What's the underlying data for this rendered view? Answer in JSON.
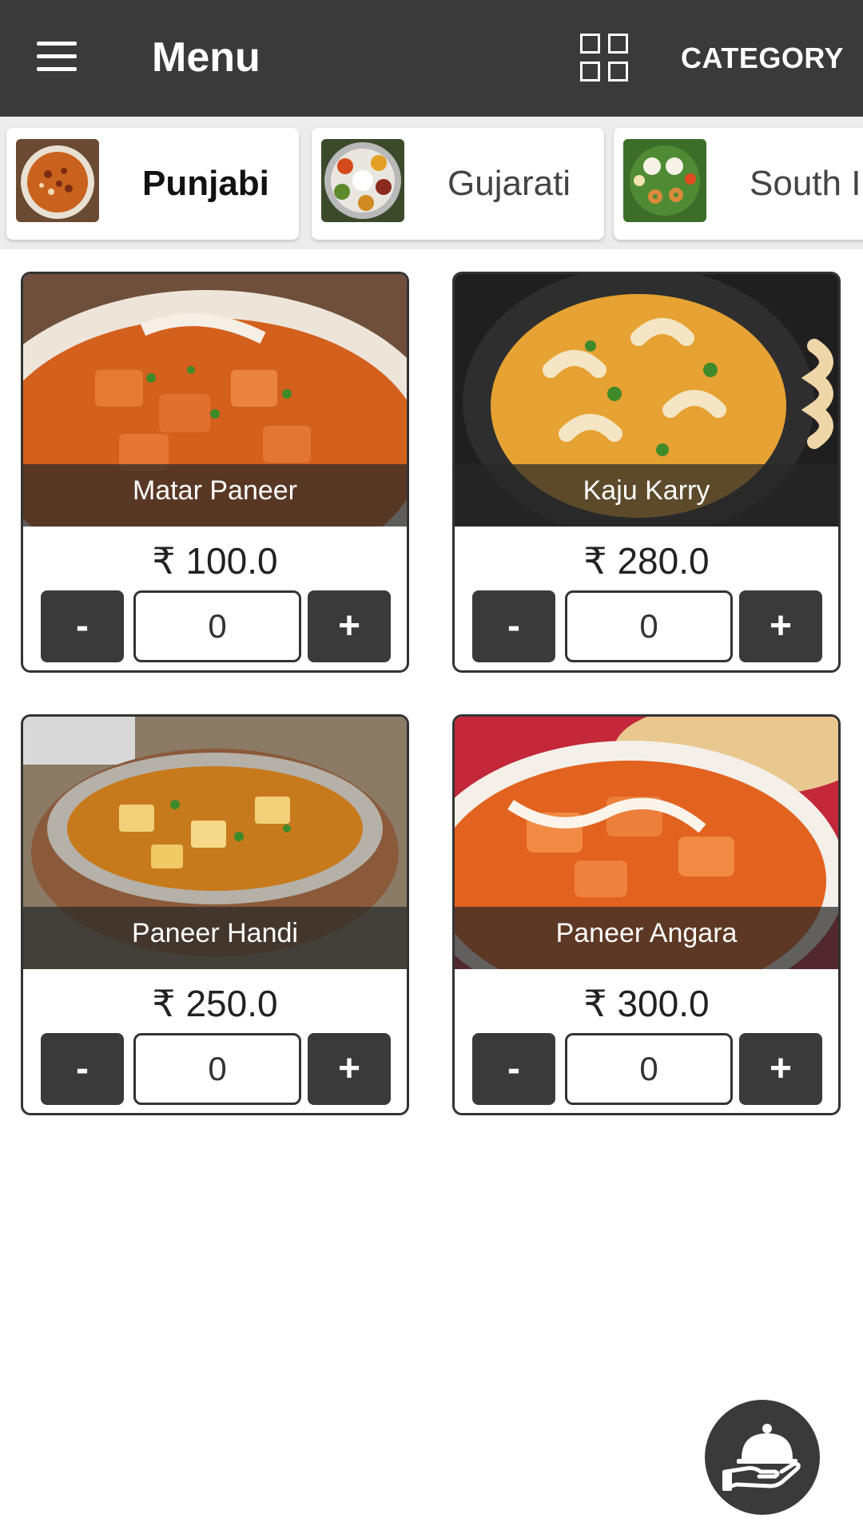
{
  "app_bar": {
    "title": "Menu",
    "menu_icon": "hamburger-icon",
    "view_icon": "grid-view-icon",
    "category_label": "CATEGORY"
  },
  "categories": [
    {
      "label": "Punjabi",
      "active": true
    },
    {
      "label": "Gujarati",
      "active": false
    },
    {
      "label": "South Indian",
      "label_visible": "South In",
      "active": false
    }
  ],
  "currency_symbol": "₹",
  "items": [
    {
      "name": "Matar Paneer",
      "price": "₹ 100.0",
      "qty": "0",
      "minus": "-",
      "plus": "+"
    },
    {
      "name": "Kaju Karry",
      "price": "₹ 280.0",
      "qty": "0",
      "minus": "-",
      "plus": "+"
    },
    {
      "name": "Paneer Handi",
      "price": "₹ 250.0",
      "qty": "0",
      "minus": "-",
      "plus": "+"
    },
    {
      "name": "Paneer Angara",
      "price": "₹ 300.0",
      "qty": "0",
      "minus": "-",
      "plus": "+"
    }
  ],
  "fab": {
    "icon": "serving-cloche-hand-icon"
  },
  "colors": {
    "primary": "#3a3a3a",
    "curry": "#d9611f"
  }
}
